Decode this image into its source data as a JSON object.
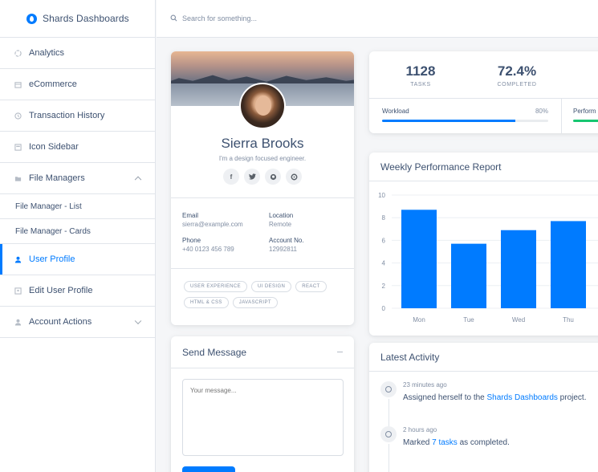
{
  "brand": {
    "name": "Shards Dashboards"
  },
  "search": {
    "placeholder": "Search for something..."
  },
  "sidebar": {
    "items": [
      {
        "label": "Analytics",
        "icon": "analytics-icon"
      },
      {
        "label": "eCommerce",
        "icon": "store-icon"
      },
      {
        "label": "Transaction History",
        "icon": "history-icon"
      },
      {
        "label": "Icon Sidebar",
        "icon": "sidebar-icon"
      },
      {
        "label": "File Managers",
        "icon": "folder-icon",
        "expanded": true
      },
      {
        "label": "File Manager - List"
      },
      {
        "label": "File Manager - Cards"
      },
      {
        "label": "User Profile",
        "icon": "user-icon",
        "active": true
      },
      {
        "label": "Edit User Profile",
        "icon": "edit-icon"
      },
      {
        "label": "Account Actions",
        "icon": "user-icon"
      }
    ]
  },
  "profile": {
    "name": "Sierra Brooks",
    "bio": "I'm a design focused engineer.",
    "socials": [
      "facebook-icon",
      "twitter-icon",
      "github-icon",
      "slack-icon"
    ],
    "email_label": "Email",
    "email": "sierra@example.com",
    "location_label": "Location",
    "location": "Remote",
    "phone_label": "Phone",
    "phone": "+40 0123 456 789",
    "account_label": "Account No.",
    "account": "12992811",
    "tags": [
      "USER EXPERIENCE",
      "UI DESIGN",
      "REACT",
      "HTML & CSS",
      "JAVASCRIPT"
    ]
  },
  "send_message": {
    "title": "Send Message",
    "placeholder": "Your message..."
  },
  "stats": {
    "tasks_value": "1128",
    "tasks_label": "TASKS",
    "completed_value": "72.4%",
    "completed_label": "COMPLETED",
    "workload_label": "Workload",
    "workload_pct": "80%",
    "workload_fill": 0.8,
    "performance_label": "Perform"
  },
  "weekly": {
    "title": "Weekly Performance Report"
  },
  "chart_data": {
    "type": "bar",
    "categories": [
      "Mon",
      "Tue",
      "Wed",
      "Thu"
    ],
    "values": [
      8.7,
      5.7,
      6.9,
      7.7
    ],
    "ylim": [
      0,
      10
    ],
    "yticks": [
      0,
      2,
      4,
      6,
      8,
      10
    ],
    "color": "#007bff",
    "grid": true
  },
  "activity": {
    "title": "Latest Activity",
    "items": [
      {
        "time": "23 minutes ago",
        "pre": "Assigned herself to the ",
        "link": "Shards Dashboards",
        "post": " project."
      },
      {
        "time": "2 hours ago",
        "pre": "Marked ",
        "link": "7 tasks",
        "post": " as completed."
      }
    ]
  },
  "colors": {
    "accent": "#007bff",
    "text": "#3d5170",
    "muted": "#818ea3",
    "success": "#17c671"
  }
}
